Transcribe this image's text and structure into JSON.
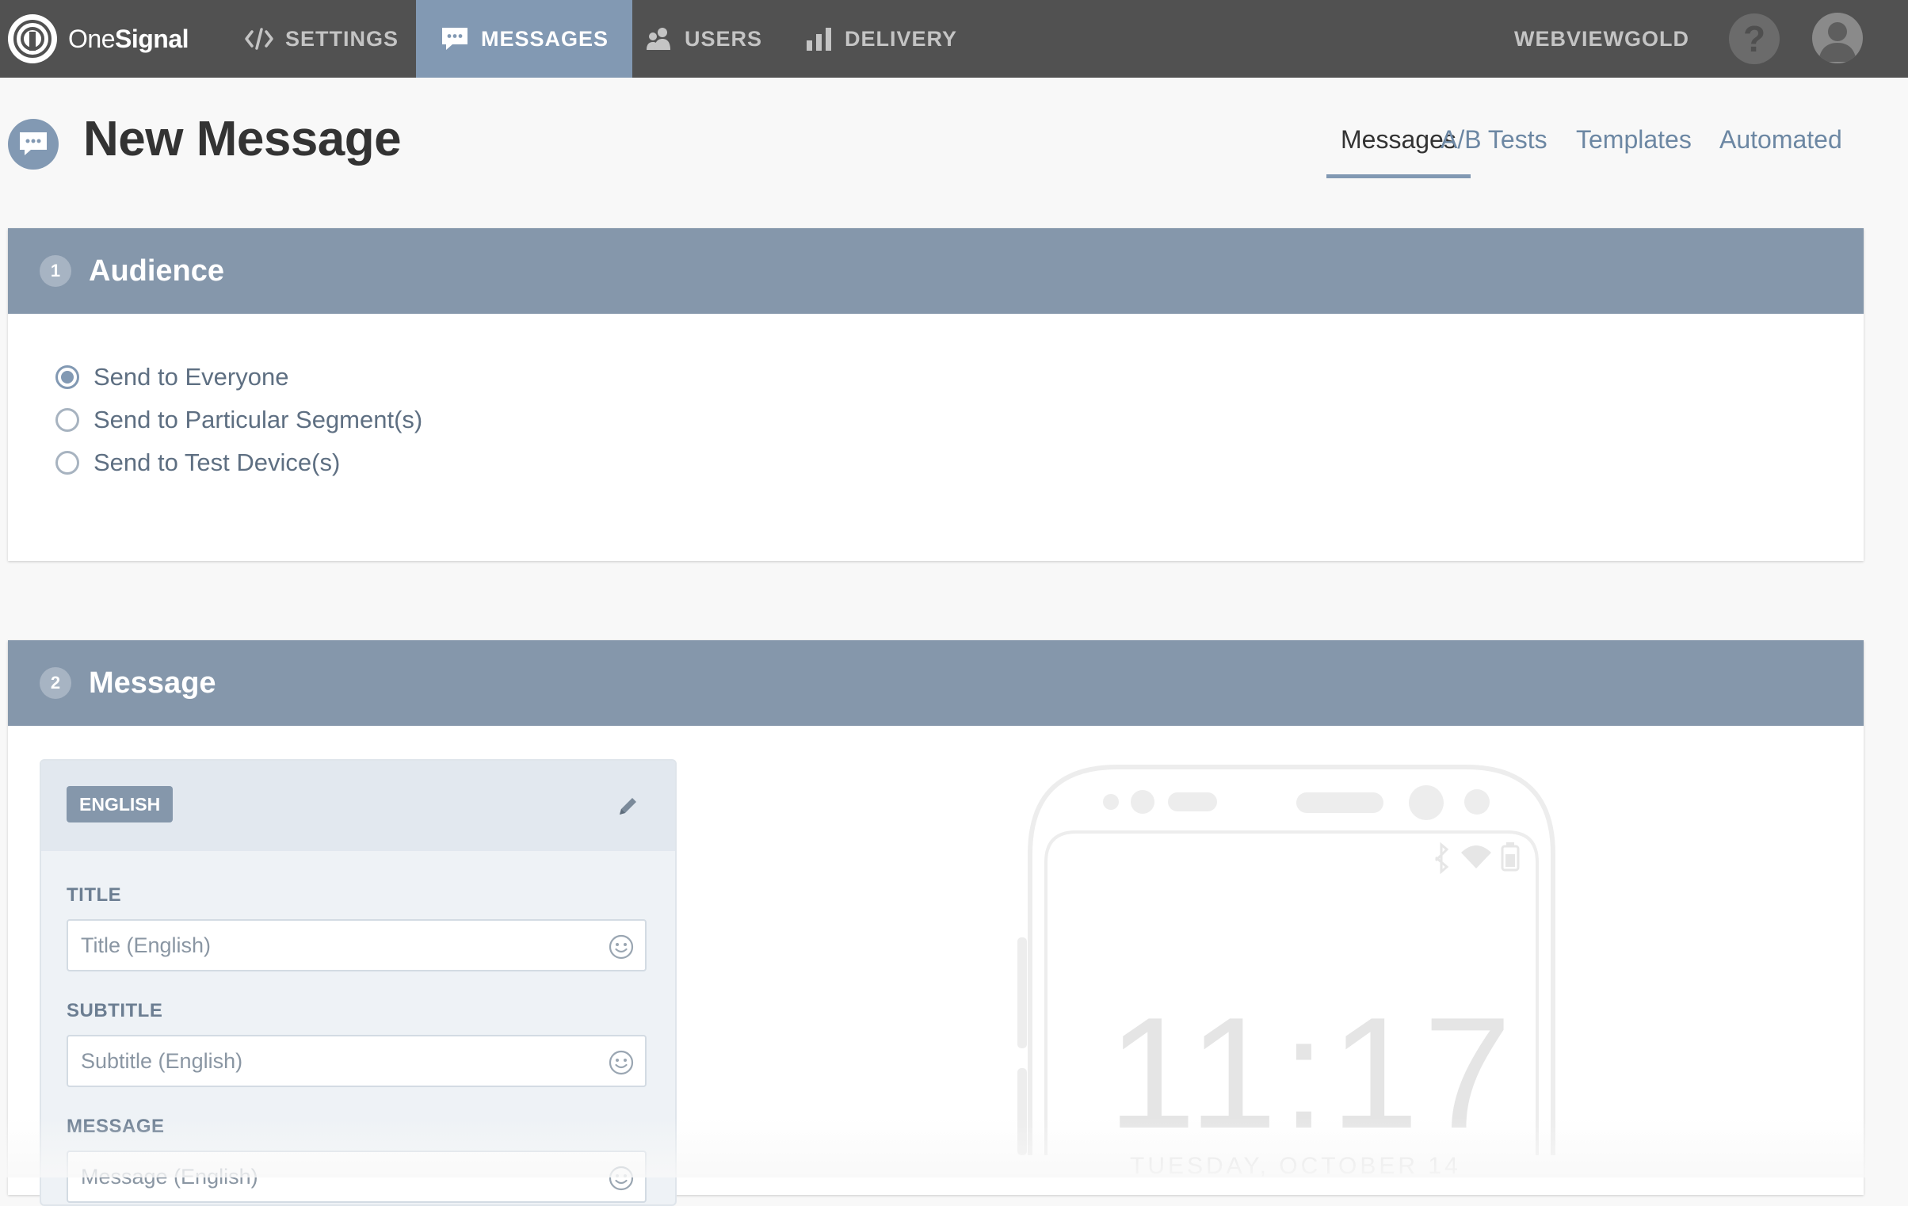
{
  "brand": {
    "name_light": "One",
    "name_bold": "Signal"
  },
  "nav": {
    "items": [
      {
        "label": "SETTINGS",
        "icon": "code-icon"
      },
      {
        "label": "MESSAGES",
        "icon": "chat-bubble-icon",
        "active": true
      },
      {
        "label": "USERS",
        "icon": "users-icon"
      },
      {
        "label": "DELIVERY",
        "icon": "bar-chart-icon"
      }
    ],
    "org": "WEBVIEWGOLD",
    "help": "?"
  },
  "page": {
    "title": "New Message"
  },
  "subtabs": [
    {
      "label": "Messages",
      "active": true
    },
    {
      "label": "A/B Tests"
    },
    {
      "label": "Templates"
    },
    {
      "label": "Automated"
    }
  ],
  "audience": {
    "step": "1",
    "title": "Audience",
    "options": [
      {
        "label": "Send to Everyone",
        "checked": true
      },
      {
        "label": "Send to Particular Segment(s)",
        "checked": false
      },
      {
        "label": "Send to Test Device(s)",
        "checked": false
      }
    ]
  },
  "message": {
    "step": "2",
    "title": "Message",
    "language": "ENGLISH",
    "fields": {
      "title": {
        "label": "TITLE",
        "placeholder": "Title (English)",
        "value": ""
      },
      "subtitle": {
        "label": "SUBTITLE",
        "placeholder": "Subtitle (English)",
        "value": ""
      },
      "message": {
        "label": "MESSAGE",
        "placeholder": "Message (English)",
        "value": ""
      }
    }
  },
  "preview": {
    "time": "11:17",
    "date": "TUESDAY, OCTOBER 14"
  },
  "colors": {
    "nav_bg": "#515151",
    "accent": "#8299b3",
    "section_header": "#8597ab"
  }
}
